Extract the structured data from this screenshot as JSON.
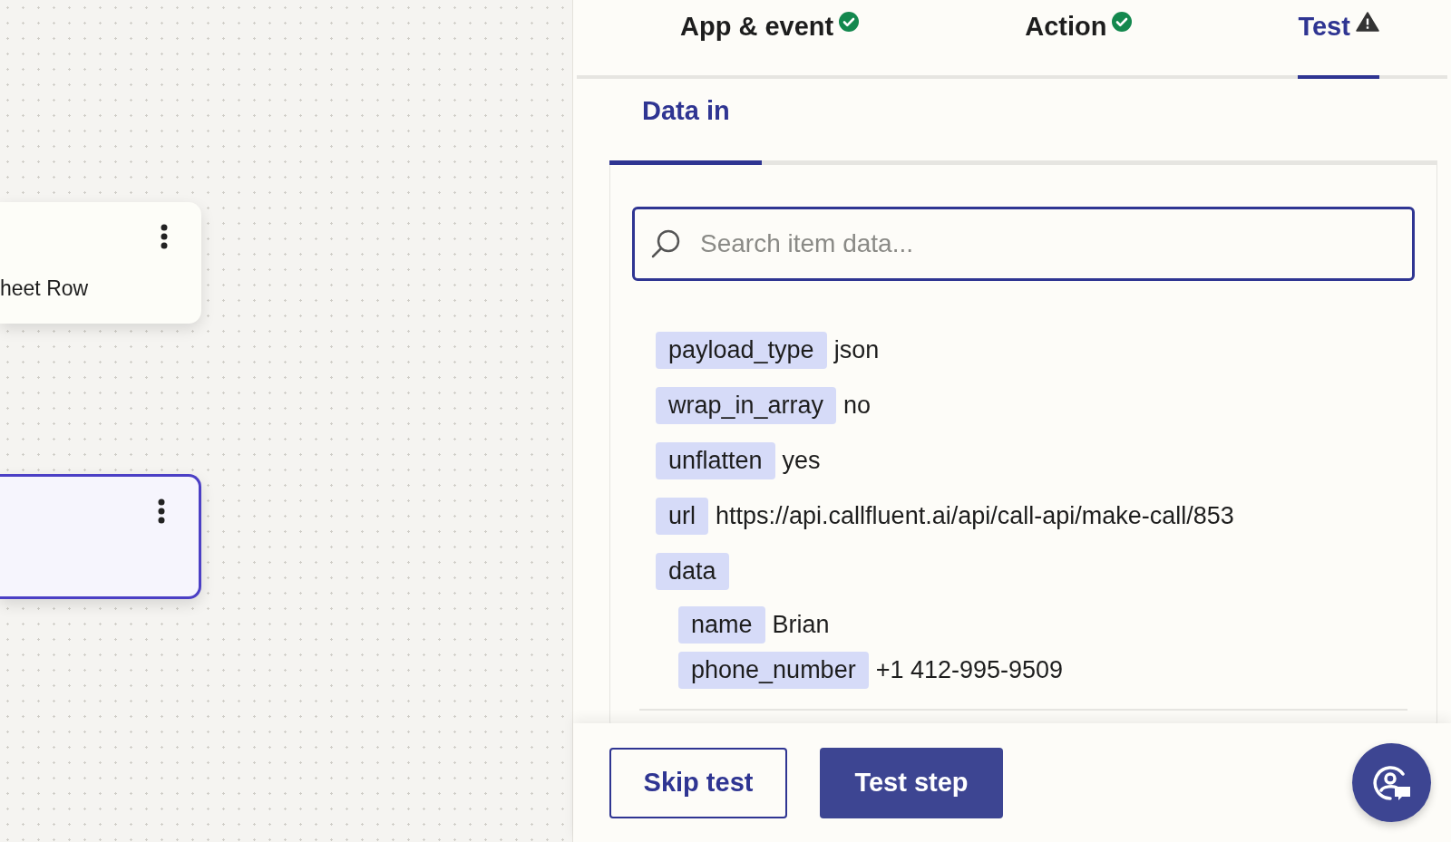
{
  "canvas": {
    "nodes": [
      {
        "text": "heet Row",
        "selected": false
      },
      {
        "selected": true
      }
    ]
  },
  "steps": [
    {
      "label": "App & event",
      "kind": "complete",
      "selected": false
    },
    {
      "label": "Action",
      "kind": "complete",
      "selected": false
    },
    {
      "label": "Test",
      "kind": "warning",
      "selected": true
    }
  ],
  "subtabs": [
    {
      "label": "Data in",
      "selected": true
    }
  ],
  "search": {
    "placeholder": "Search item data..."
  },
  "fields": [
    {
      "key": "payload_type",
      "value": "json"
    },
    {
      "key": "wrap_in_array",
      "value": "no"
    },
    {
      "key": "unflatten",
      "value": "yes"
    },
    {
      "key": "url",
      "value": "https://api.callfluent.ai/api/call-api/make-call/853"
    },
    {
      "key": "data",
      "children": [
        {
          "key": "name",
          "value": "Brian"
        },
        {
          "key": "phone_number",
          "value": "+1 412-995-9509"
        }
      ]
    }
  ],
  "buttons": [
    {
      "label": "Skip test",
      "kind": "secondary"
    },
    {
      "label": "Test step",
      "kind": "primary"
    }
  ]
}
